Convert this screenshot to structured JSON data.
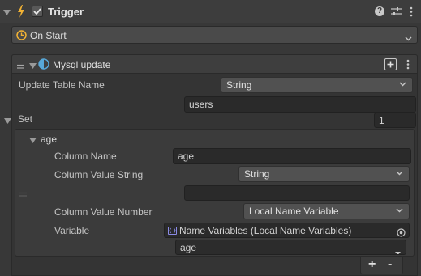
{
  "header": {
    "title": "Trigger",
    "enabled": true,
    "icons": [
      "lightning-icon",
      "checkbox-icon",
      "help-icon",
      "preset-icon",
      "kebab-menu-icon"
    ]
  },
  "event": {
    "label": "On Start"
  },
  "instruction": {
    "title": "Mysql update",
    "icons": [
      "drag-handle-icon",
      "foldout-icon",
      "half-circle-icon",
      "add-icon",
      "kebab-menu-icon"
    ]
  },
  "update_table": {
    "label": "Update Table Name",
    "type_value": "String",
    "value": "users"
  },
  "set": {
    "label": "Set",
    "count": "1",
    "item": {
      "title": "age",
      "column_name_label": "Column Name",
      "column_name_value": "age",
      "column_value_string_label": "Column Value String",
      "column_value_string_type": "String",
      "column_value_string_value": "",
      "column_value_number_label": "Column Value Number",
      "column_value_number_type": "Local Name Variable",
      "variable_label": "Variable",
      "variable_value": "Name Variables (Local Name Variables)",
      "variable_name": "age"
    },
    "add_label": "+",
    "remove_label": "-"
  },
  "colors": {
    "background": "#383838",
    "header_bg": "#3c3c3c",
    "lightning": "#f2b233",
    "clock": "#f2b233",
    "half_circle": "#58a8d8",
    "variable_icon": "#8a8ae6"
  }
}
